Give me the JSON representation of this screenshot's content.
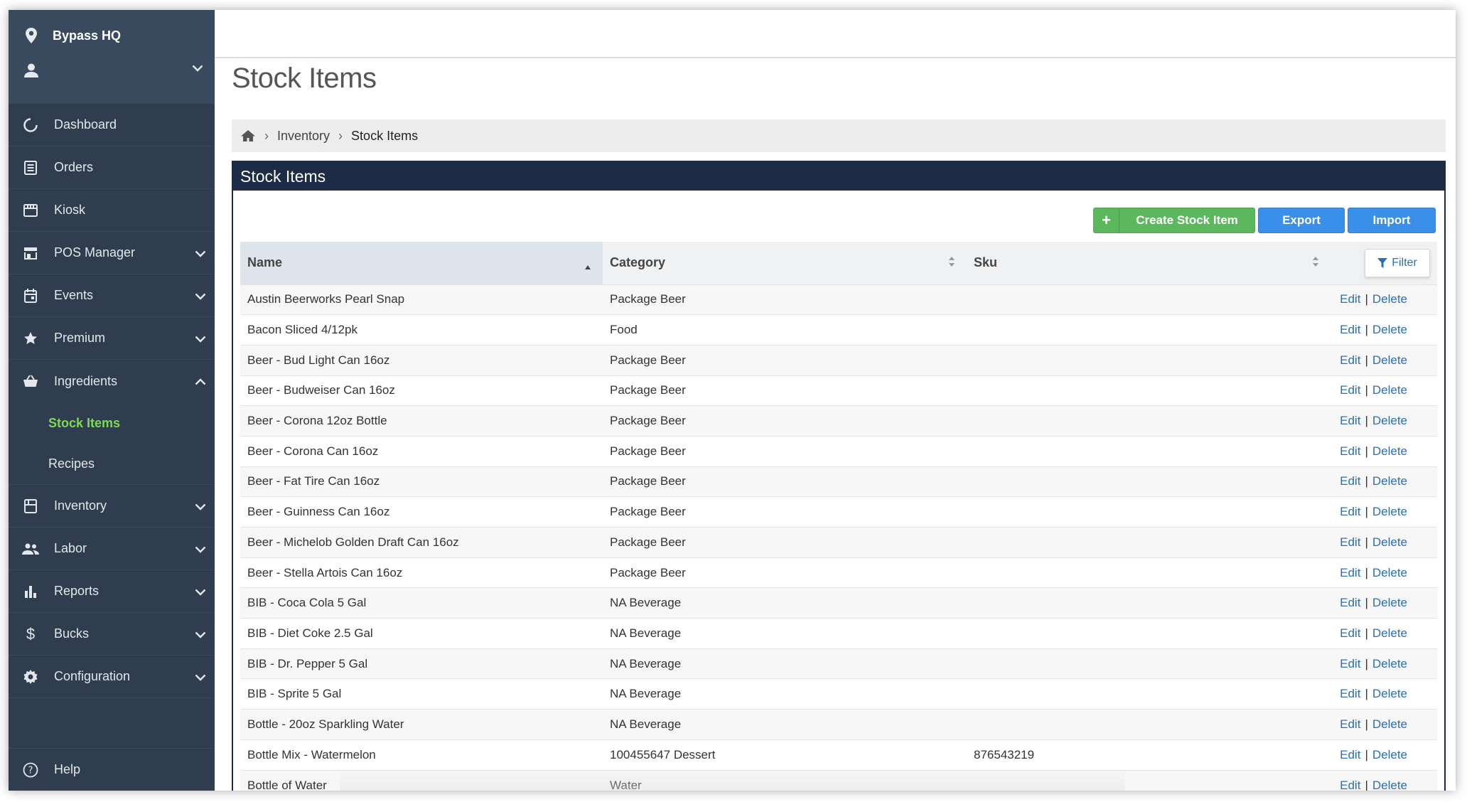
{
  "sidebar": {
    "location": "Bypass HQ",
    "items": [
      {
        "label": "Dashboard"
      },
      {
        "label": "Orders"
      },
      {
        "label": "Kiosk"
      },
      {
        "label": "POS Manager"
      },
      {
        "label": "Events"
      },
      {
        "label": "Premium"
      },
      {
        "label": "Ingredients"
      },
      {
        "label": "Inventory"
      },
      {
        "label": "Labor"
      },
      {
        "label": "Reports"
      },
      {
        "label": "Bucks"
      },
      {
        "label": "Configuration"
      }
    ],
    "subitems": [
      {
        "label": "Stock Items",
        "active": true
      },
      {
        "label": "Recipes",
        "active": false
      }
    ],
    "help": "Help",
    "active_color": "#7ed957"
  },
  "page": {
    "title": "Stock Items"
  },
  "breadcrumb": {
    "items": [
      "Inventory",
      "Stock Items"
    ]
  },
  "panel": {
    "title": "Stock Items",
    "buttons": {
      "create": "Create Stock Item",
      "export": "Export",
      "import": "Import"
    },
    "filter_label": "Filter"
  },
  "table": {
    "columns": [
      "Name",
      "Category",
      "Sku"
    ],
    "action_edit": "Edit",
    "action_delete": "Delete",
    "action_sep": "|",
    "rows": [
      {
        "name": "Austin Beerworks Pearl Snap",
        "category": "Package Beer",
        "sku": ""
      },
      {
        "name": "Bacon Sliced 4/12pk",
        "category": "Food",
        "sku": ""
      },
      {
        "name": "Beer - Bud Light Can 16oz",
        "category": "Package Beer",
        "sku": ""
      },
      {
        "name": "Beer - Budweiser Can 16oz",
        "category": "Package Beer",
        "sku": ""
      },
      {
        "name": "Beer - Corona 12oz Bottle",
        "category": "Package Beer",
        "sku": ""
      },
      {
        "name": "Beer - Corona Can 16oz",
        "category": "Package Beer",
        "sku": ""
      },
      {
        "name": "Beer - Fat Tire Can 16oz",
        "category": "Package Beer",
        "sku": ""
      },
      {
        "name": "Beer - Guinness Can 16oz",
        "category": "Package Beer",
        "sku": ""
      },
      {
        "name": "Beer - Michelob Golden Draft Can 16oz",
        "category": "Package Beer",
        "sku": ""
      },
      {
        "name": "Beer - Stella Artois Can 16oz",
        "category": "Package Beer",
        "sku": ""
      },
      {
        "name": "BIB - Coca Cola 5 Gal",
        "category": "NA Beverage",
        "sku": ""
      },
      {
        "name": "BIB - Diet Coke 2.5 Gal",
        "category": "NA Beverage",
        "sku": ""
      },
      {
        "name": "BIB - Dr. Pepper 5 Gal",
        "category": "NA Beverage",
        "sku": ""
      },
      {
        "name": "BIB - Sprite 5 Gal",
        "category": "NA Beverage",
        "sku": ""
      },
      {
        "name": "Bottle - 20oz Sparkling Water",
        "category": "NA Beverage",
        "sku": ""
      },
      {
        "name": "Bottle Mix - Watermelon",
        "category": "100455647 Dessert",
        "sku": "876543219"
      },
      {
        "name": "Bottle of Water",
        "category": "Water",
        "sku": ""
      }
    ]
  }
}
